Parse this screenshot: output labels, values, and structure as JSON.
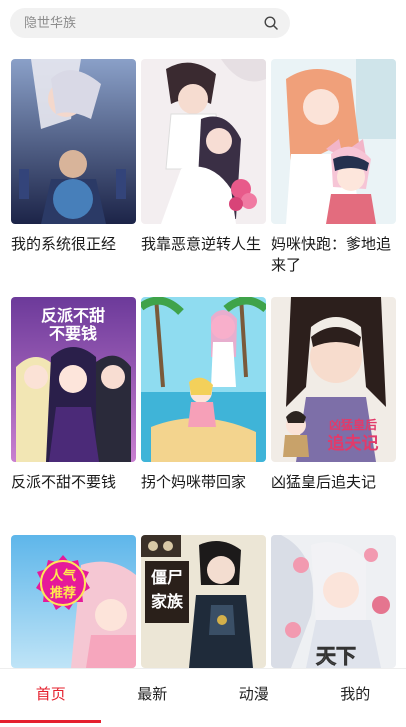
{
  "search": {
    "placeholder": "隐世华族"
  },
  "comics": [
    {
      "title": "我的系统很正经"
    },
    {
      "title": "我靠恶意逆转人生"
    },
    {
      "title": "妈咪快跑：爹地追来了"
    },
    {
      "title": "反派不甜不要钱",
      "cover_text": "反派不甜 不要钱"
    },
    {
      "title": "拐个妈咪带回家"
    },
    {
      "title": "凶猛皇后追夫记",
      "cover_text": "凶猛皇后 追夫记"
    },
    {
      "title": "",
      "cover_badge": [
        "人气",
        "推荐"
      ]
    },
    {
      "title": "",
      "cover_text": "僵尸 家族"
    },
    {
      "title": "",
      "cover_text": "天下"
    }
  ],
  "tabs": [
    {
      "label": "首页",
      "active": true
    },
    {
      "label": "最新"
    },
    {
      "label": "动漫"
    },
    {
      "label": "我的"
    }
  ],
  "colors": {
    "accent": "#e5202e",
    "search_bg": "#f1f1f1"
  }
}
